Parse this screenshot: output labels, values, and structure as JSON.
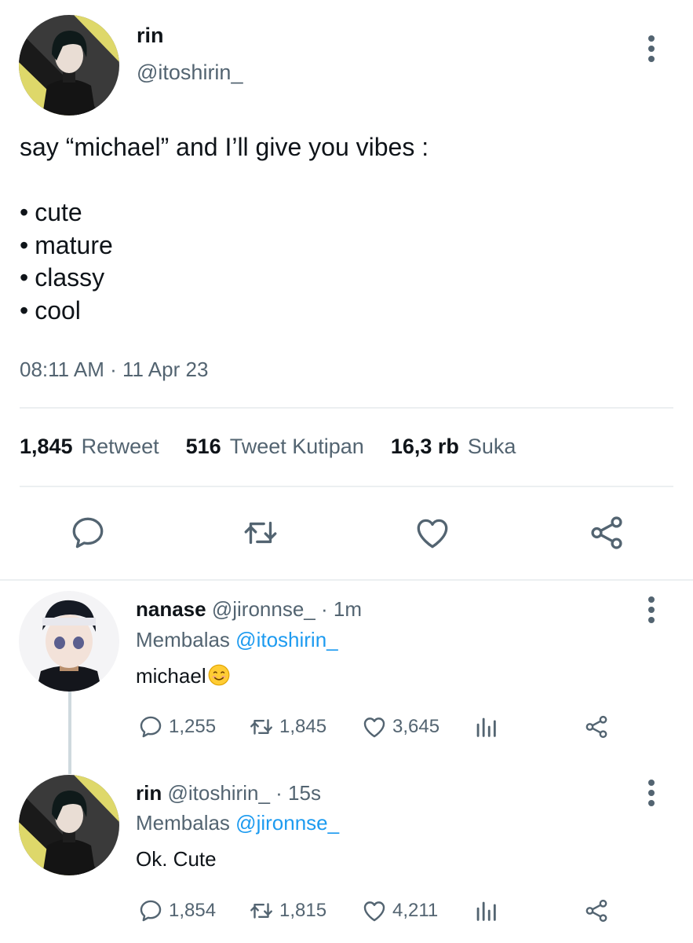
{
  "tweet": {
    "author_name": "rin",
    "author_handle": "@itoshirin_",
    "text_line": "say “michael” and I’ll give you vibes :",
    "bullets": [
      "cute",
      "mature",
      "classy",
      "cool"
    ],
    "timestamp": "08:11 AM · 11 Apr 23",
    "stats": {
      "retweets": "1,845",
      "retweets_label": "Retweet",
      "quotes": "516",
      "quotes_label": "Tweet Kutipan",
      "likes": "16,3 rb",
      "likes_label": "Suka"
    }
  },
  "replies": [
    {
      "name": "nanase",
      "handle_time": "@jironnse_ · 1m",
      "replying_prefix": "Membalas",
      "replying_to": "@itoshirin_",
      "text": "michael",
      "emoji": "smiling-face-emoji",
      "replies": "1,255",
      "retweets": "1,845",
      "likes": "3,645"
    },
    {
      "name": "rin",
      "handle_time": "@itoshirin_ · 15s",
      "replying_prefix": "Membalas",
      "replying_to": "@jironnse_",
      "text": "Ok. Cute",
      "replies": "1,854",
      "retweets": "1,815",
      "likes": "4,211"
    }
  ],
  "icons": {
    "reply": "reply-icon",
    "retweet": "retweet-icon",
    "like": "heart-icon",
    "share": "share-icon",
    "analytics": "analytics-icon",
    "more": "more-icon"
  },
  "colors": {
    "text_primary": "#0f1419",
    "text_secondary": "#536471",
    "link": "#1d9bf0",
    "divider": "#eceff1",
    "avatar_yellow": "#ded86a"
  }
}
